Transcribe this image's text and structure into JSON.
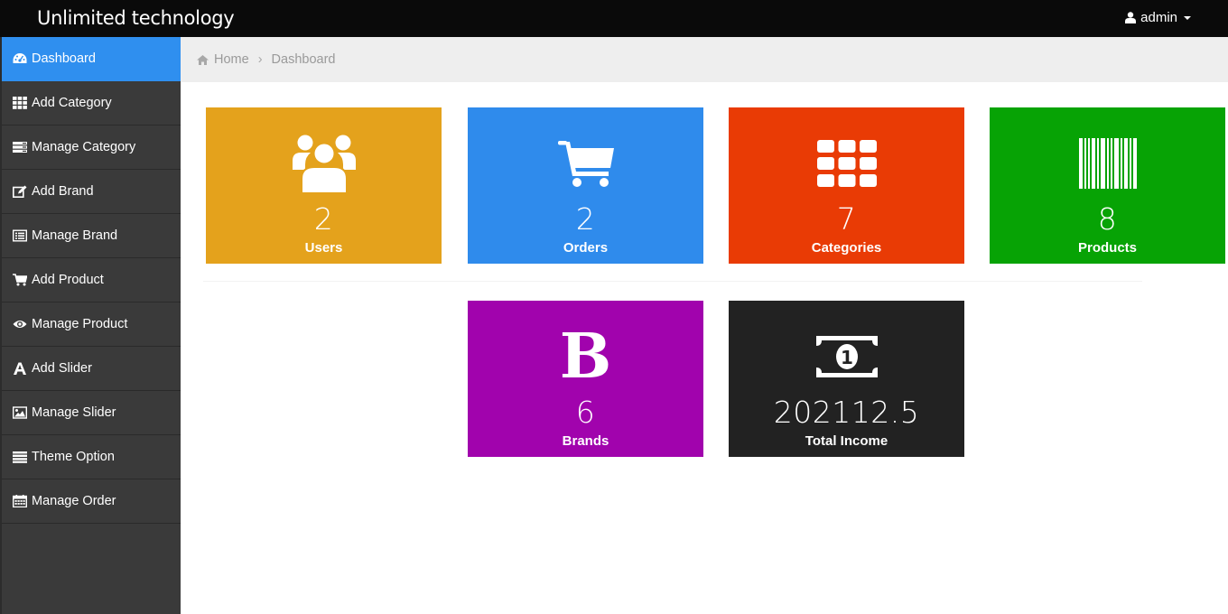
{
  "app": {
    "title": "Unlimited technology",
    "user": "admin"
  },
  "sidebar": {
    "items": [
      {
        "label": "Dashboard",
        "icon": "dashboard-icon"
      },
      {
        "label": "Add Category",
        "icon": "grid-icon"
      },
      {
        "label": "Manage Category",
        "icon": "list-icon"
      },
      {
        "label": "Add Brand",
        "icon": "edit-icon"
      },
      {
        "label": "Manage Brand",
        "icon": "list-alt-icon"
      },
      {
        "label": "Add Product",
        "icon": "cart-icon"
      },
      {
        "label": "Manage Product",
        "icon": "eye-icon"
      },
      {
        "label": "Add Slider",
        "icon": "font-icon"
      },
      {
        "label": "Manage Slider",
        "icon": "picture-icon"
      },
      {
        "label": "Theme Option",
        "icon": "menu-icon"
      },
      {
        "label": "Manage Order",
        "icon": "calendar-icon"
      }
    ]
  },
  "breadcrumb": {
    "home": "Home",
    "current": "Dashboard"
  },
  "cards": [
    {
      "count": "2",
      "label": "Users",
      "color": "#e4a21c",
      "icon": "users-icon"
    },
    {
      "count": "2",
      "label": "Orders",
      "color": "#2f8bec",
      "icon": "cart-icon"
    },
    {
      "count": "7",
      "label": "Categories",
      "color": "#e93b05",
      "icon": "grid-icon"
    },
    {
      "count": "8",
      "label": "Products",
      "color": "#07a305",
      "icon": "barcode-icon"
    },
    {
      "count": "6",
      "label": "Brands",
      "color": "#a103ad",
      "icon": "bold-b-icon",
      "glyph": "B"
    },
    {
      "count": "202112.5",
      "label": "Total Income",
      "color": "#222222",
      "icon": "money-icon",
      "glyph": "1"
    }
  ],
  "colors": {
    "topbar": "#0a0a0a",
    "sidebar": "#3a3a3a",
    "active": "#2f8fef",
    "breadcrumb_bg": "#eeeeee"
  }
}
